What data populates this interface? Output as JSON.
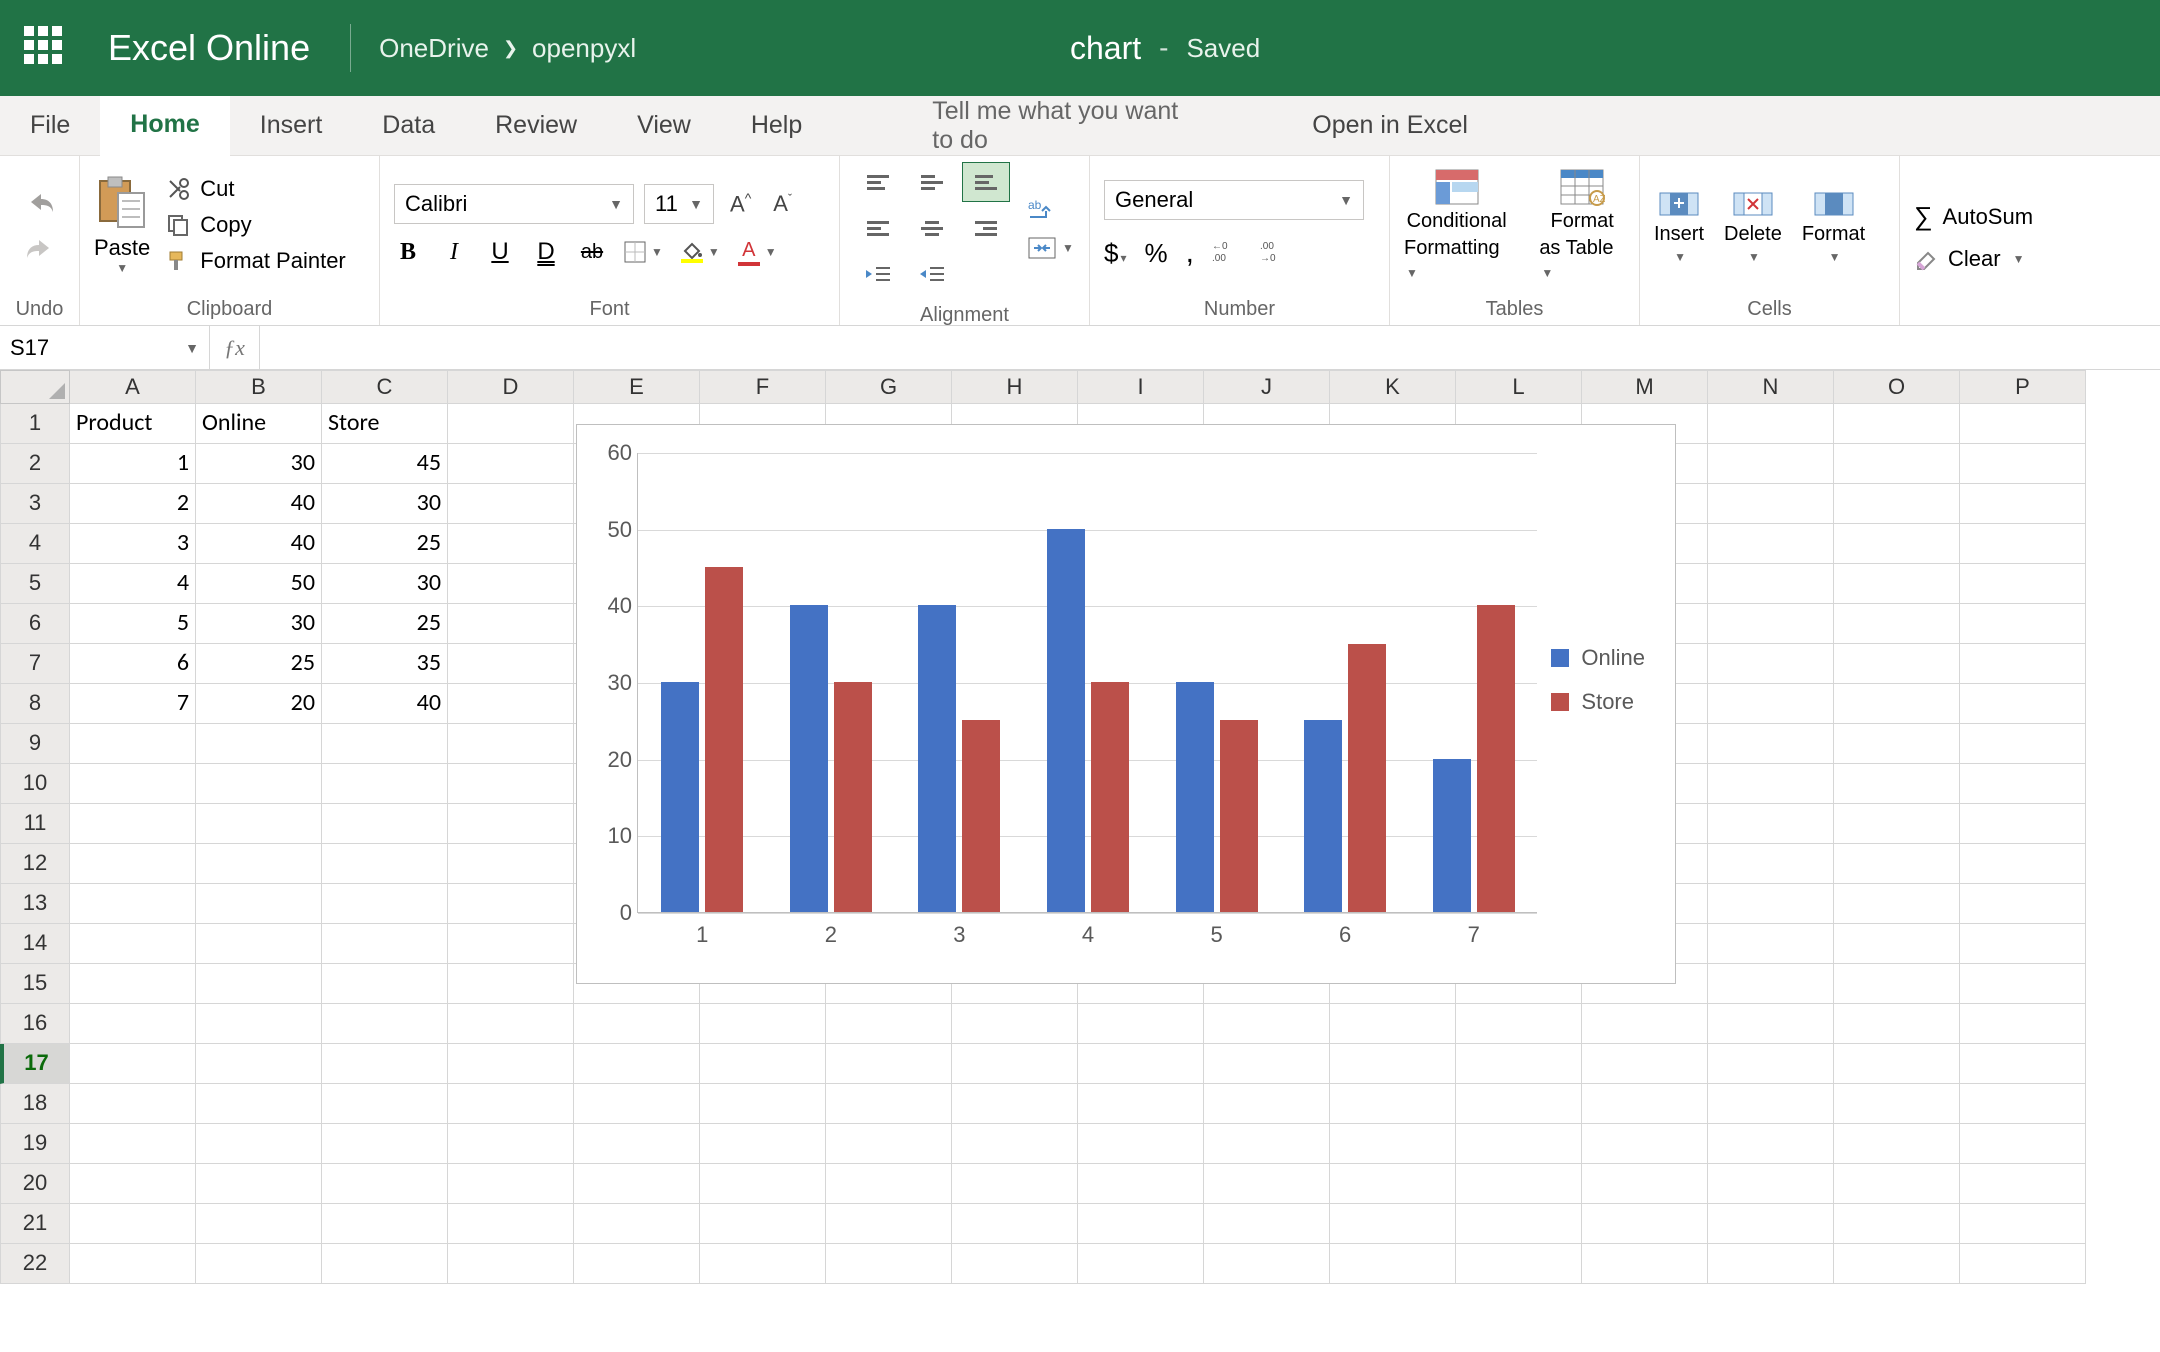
{
  "titlebar": {
    "app_name": "Excel Online",
    "breadcrumb": [
      "OneDrive",
      "openpyxl"
    ],
    "doc_name": "chart",
    "saved": "Saved"
  },
  "menubar": {
    "items": [
      "File",
      "Home",
      "Insert",
      "Data",
      "Review",
      "View",
      "Help"
    ],
    "tell_me": "Tell me what you want to do",
    "open_in_excel": "Open in Excel",
    "selected": "Home"
  },
  "ribbon": {
    "undo": {
      "label": "Undo"
    },
    "clipboard": {
      "label": "Clipboard",
      "paste": "Paste",
      "cut": "Cut",
      "copy": "Copy",
      "format_painter": "Format Painter"
    },
    "font": {
      "label": "Font",
      "name": "Calibri",
      "size": "11"
    },
    "alignment": {
      "label": "Alignment"
    },
    "number": {
      "label": "Number",
      "format": "General"
    },
    "tables": {
      "label": "Tables",
      "cf": "Conditional",
      "cf2": "Formatting",
      "ft": "Format",
      "ft2": "as Table"
    },
    "cells": {
      "label": "Cells",
      "insert": "Insert",
      "delete": "Delete",
      "format": "Format"
    },
    "editing": {
      "autosum": "AutoSum",
      "clear": "Clear"
    }
  },
  "formula_bar": {
    "name_box": "S17"
  },
  "columns": [
    "A",
    "B",
    "C",
    "D",
    "E",
    "F",
    "G",
    "H",
    "I",
    "J",
    "K",
    "L",
    "M",
    "N",
    "O",
    "P"
  ],
  "row_count": 22,
  "selected_row": 17,
  "sheet": {
    "headers": [
      "Product",
      "Online",
      "Store"
    ],
    "rows": [
      [
        1,
        30,
        45
      ],
      [
        2,
        40,
        30
      ],
      [
        3,
        40,
        25
      ],
      [
        4,
        50,
        30
      ],
      [
        5,
        30,
        25
      ],
      [
        6,
        25,
        35
      ],
      [
        7,
        20,
        40
      ]
    ]
  },
  "chart_data": {
    "type": "bar",
    "categories": [
      "1",
      "2",
      "3",
      "4",
      "5",
      "6",
      "7"
    ],
    "series": [
      {
        "name": "Online",
        "values": [
          30,
          40,
          40,
          50,
          30,
          25,
          20
        ],
        "color": "#4472c4"
      },
      {
        "name": "Store",
        "values": [
          45,
          30,
          25,
          30,
          25,
          35,
          40
        ],
        "color": "#bb504a"
      }
    ],
    "ylim": [
      0,
      60
    ],
    "yticks": [
      0,
      10,
      20,
      30,
      40,
      50,
      60
    ]
  }
}
